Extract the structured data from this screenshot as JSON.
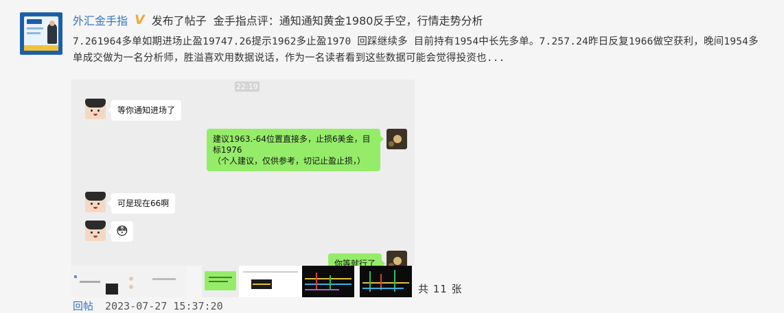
{
  "post": {
    "author": "外汇金手指",
    "badge": "V",
    "action": "发布了帖子",
    "title": "金手指点评：通知通知黄金1980反手空，行情走势分析",
    "excerpt": "7.261964多单如期进场止盈19747.26提示1962多止盈1970 回踩继续多 目前持有1954中长先多单。7.257.24昨日反复1966做空获利，晚间1954多单成交做为一名分析师，胜溢喜欢用数据说话，作为一名读者看到这些数据可能会觉得投资也..."
  },
  "chat": {
    "time": "22:19",
    "messages": [
      {
        "side": "left",
        "text": "等你通知进场了"
      },
      {
        "side": "right",
        "text": "建议1963.-64位置直接多，止损6美金，目标1976\n（个人建议，仅供参考，切记止盈止损，）"
      },
      {
        "side": "left",
        "text": "可是现在66啊"
      },
      {
        "side": "left",
        "text": "😳"
      },
      {
        "side": "right",
        "text": "你等就行了"
      }
    ]
  },
  "images": {
    "count_label": "共 11 张"
  },
  "footer": {
    "reply_label": "回帖",
    "timestamp": "2023-07-27 15:37:20"
  },
  "colors": {
    "link": "#3573c0",
    "badge": "#f2a93b",
    "bubble_right": "#95ec69",
    "bubble_left": "#ffffff",
    "background": "#f5f5f5"
  },
  "icons": [
    "verified-v-icon",
    "user-avatar",
    "chat-avatar-cartoon",
    "chat-avatar-self"
  ]
}
